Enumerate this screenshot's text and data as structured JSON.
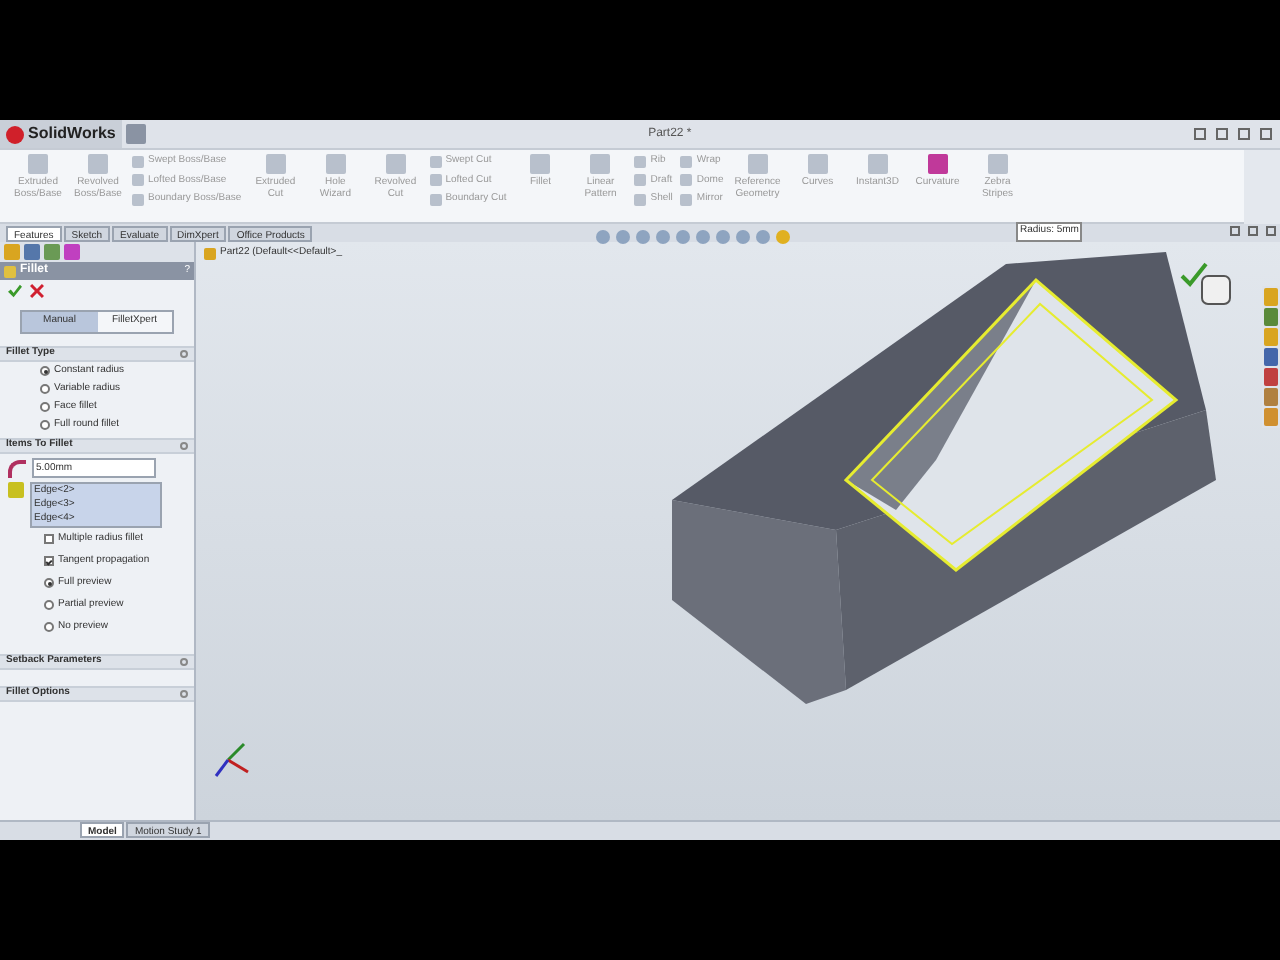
{
  "app": {
    "logo": "SolidWorks",
    "title": "Part22 *"
  },
  "ribbon": [
    {
      "kind": "big",
      "label": "Extruded Boss/Base"
    },
    {
      "kind": "big",
      "label": "Revolved Boss/Base"
    },
    {
      "kind": "stack",
      "items": [
        "Swept Boss/Base",
        "Lofted Boss/Base",
        "Boundary Boss/Base"
      ]
    },
    {
      "kind": "big",
      "label": "Extruded Cut"
    },
    {
      "kind": "big",
      "label": "Hole Wizard"
    },
    {
      "kind": "big",
      "label": "Revolved Cut"
    },
    {
      "kind": "stack",
      "items": [
        "Swept Cut",
        "Lofted Cut",
        "Boundary Cut"
      ]
    },
    {
      "kind": "big",
      "label": "Fillet"
    },
    {
      "kind": "big",
      "label": "Linear Pattern"
    },
    {
      "kind": "stack",
      "items": [
        "Rib",
        "Draft",
        "Shell"
      ]
    },
    {
      "kind": "stack",
      "items": [
        "Wrap",
        "Dome",
        "Mirror"
      ]
    },
    {
      "kind": "big",
      "label": "Reference Geometry"
    },
    {
      "kind": "big",
      "label": "Curves"
    },
    {
      "kind": "big",
      "label": "Instant3D"
    },
    {
      "kind": "big",
      "label": "Curvature"
    },
    {
      "kind": "big",
      "label": "Zebra Stripes"
    }
  ],
  "tabs": [
    {
      "label": "Features",
      "selected": true
    },
    {
      "label": "Sketch",
      "selected": false
    },
    {
      "label": "Evaluate",
      "selected": false
    },
    {
      "label": "DimXpert",
      "selected": false
    },
    {
      "label": "Office Products",
      "selected": false
    }
  ],
  "panel": {
    "title": "Fillet",
    "help": "?",
    "modes": [
      {
        "label": "Manual",
        "selected": true
      },
      {
        "label": "FilletXpert",
        "selected": false
      }
    ],
    "fillet_type": {
      "title": "Fillet Type",
      "options": [
        {
          "label": "Constant radius",
          "selected": true
        },
        {
          "label": "Variable radius",
          "selected": false
        },
        {
          "label": "Face fillet",
          "selected": false
        },
        {
          "label": "Full round fillet",
          "selected": false
        }
      ]
    },
    "items": {
      "title": "Items To Fillet",
      "radius": "5.00mm",
      "edges": [
        "Edge<2>",
        "Edge<3>",
        "Edge<4>"
      ],
      "checks": [
        {
          "label": "Multiple radius fillet",
          "checked": false
        },
        {
          "label": "Tangent propagation",
          "checked": true
        }
      ],
      "preview": [
        {
          "label": "Full preview",
          "selected": true
        },
        {
          "label": "Partial preview",
          "selected": false
        },
        {
          "label": "No preview",
          "selected": false
        }
      ]
    },
    "sections": [
      "Setback Parameters",
      "Fillet Options"
    ]
  },
  "viewport": {
    "tree_item": "Part22  (Default<<Default>_",
    "tooltip": "Radius: 5mm"
  },
  "bottom_tabs": [
    {
      "label": "Model",
      "selected": true
    },
    {
      "label": "Motion Study 1",
      "selected": false
    }
  ]
}
